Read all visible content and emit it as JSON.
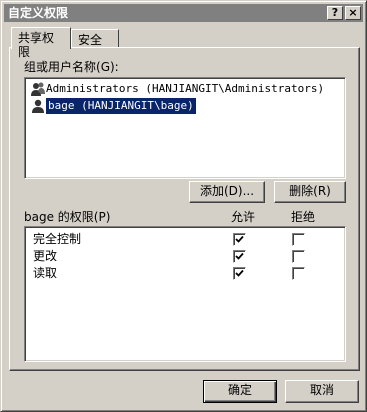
{
  "window": {
    "title": "自定义权限",
    "help_glyph": "?",
    "close_glyph": "×"
  },
  "tabs": [
    {
      "label": "共享权限",
      "active": true
    },
    {
      "label": "安全",
      "active": false
    }
  ],
  "users_section": {
    "label": "组或用户名称",
    "accel": "(G):",
    "accel_key": "G",
    "users": [
      {
        "name": "Administrators (HANJIANGIT\\Administrators)",
        "icon": "user-group-icon",
        "selected": false
      },
      {
        "name": "bage (HANJIANGIT\\bage)",
        "icon": "user-icon",
        "selected": true
      }
    ]
  },
  "buttons": {
    "add": "添加(D)...",
    "remove": "删除(R)",
    "ok": "确定",
    "cancel": "取消"
  },
  "permissions": {
    "header_label": "bage 的权限(P)",
    "allow_header": "允许",
    "deny_header": "拒绝",
    "rows": [
      {
        "name": "完全控制",
        "allow": true,
        "deny": false
      },
      {
        "name": "更改",
        "allow": true,
        "deny": false
      },
      {
        "name": "读取",
        "allow": true,
        "deny": false
      }
    ]
  },
  "colors": {
    "face": "#d4d0c8",
    "selection": "#0a246a",
    "titlebar_inactive": "#808080"
  }
}
